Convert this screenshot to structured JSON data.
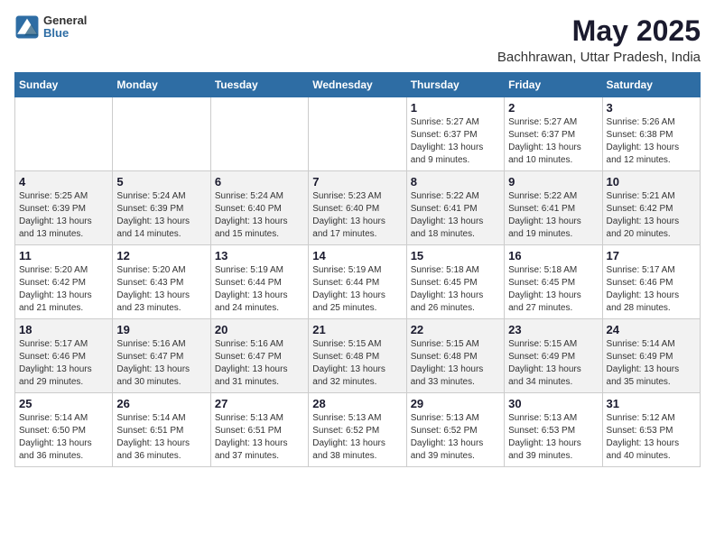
{
  "logo": {
    "line1": "General",
    "line2": "Blue"
  },
  "title": "May 2025",
  "subtitle": "Bachhrawan, Uttar Pradesh, India",
  "days_header": [
    "Sunday",
    "Monday",
    "Tuesday",
    "Wednesday",
    "Thursday",
    "Friday",
    "Saturday"
  ],
  "weeks": [
    [
      {
        "day": "",
        "info": ""
      },
      {
        "day": "",
        "info": ""
      },
      {
        "day": "",
        "info": ""
      },
      {
        "day": "",
        "info": ""
      },
      {
        "day": "1",
        "info": "Sunrise: 5:27 AM\nSunset: 6:37 PM\nDaylight: 13 hours and 9 minutes."
      },
      {
        "day": "2",
        "info": "Sunrise: 5:27 AM\nSunset: 6:37 PM\nDaylight: 13 hours and 10 minutes."
      },
      {
        "day": "3",
        "info": "Sunrise: 5:26 AM\nSunset: 6:38 PM\nDaylight: 13 hours and 12 minutes."
      }
    ],
    [
      {
        "day": "4",
        "info": "Sunrise: 5:25 AM\nSunset: 6:39 PM\nDaylight: 13 hours and 13 minutes."
      },
      {
        "day": "5",
        "info": "Sunrise: 5:24 AM\nSunset: 6:39 PM\nDaylight: 13 hours and 14 minutes."
      },
      {
        "day": "6",
        "info": "Sunrise: 5:24 AM\nSunset: 6:40 PM\nDaylight: 13 hours and 15 minutes."
      },
      {
        "day": "7",
        "info": "Sunrise: 5:23 AM\nSunset: 6:40 PM\nDaylight: 13 hours and 17 minutes."
      },
      {
        "day": "8",
        "info": "Sunrise: 5:22 AM\nSunset: 6:41 PM\nDaylight: 13 hours and 18 minutes."
      },
      {
        "day": "9",
        "info": "Sunrise: 5:22 AM\nSunset: 6:41 PM\nDaylight: 13 hours and 19 minutes."
      },
      {
        "day": "10",
        "info": "Sunrise: 5:21 AM\nSunset: 6:42 PM\nDaylight: 13 hours and 20 minutes."
      }
    ],
    [
      {
        "day": "11",
        "info": "Sunrise: 5:20 AM\nSunset: 6:42 PM\nDaylight: 13 hours and 21 minutes."
      },
      {
        "day": "12",
        "info": "Sunrise: 5:20 AM\nSunset: 6:43 PM\nDaylight: 13 hours and 23 minutes."
      },
      {
        "day": "13",
        "info": "Sunrise: 5:19 AM\nSunset: 6:44 PM\nDaylight: 13 hours and 24 minutes."
      },
      {
        "day": "14",
        "info": "Sunrise: 5:19 AM\nSunset: 6:44 PM\nDaylight: 13 hours and 25 minutes."
      },
      {
        "day": "15",
        "info": "Sunrise: 5:18 AM\nSunset: 6:45 PM\nDaylight: 13 hours and 26 minutes."
      },
      {
        "day": "16",
        "info": "Sunrise: 5:18 AM\nSunset: 6:45 PM\nDaylight: 13 hours and 27 minutes."
      },
      {
        "day": "17",
        "info": "Sunrise: 5:17 AM\nSunset: 6:46 PM\nDaylight: 13 hours and 28 minutes."
      }
    ],
    [
      {
        "day": "18",
        "info": "Sunrise: 5:17 AM\nSunset: 6:46 PM\nDaylight: 13 hours and 29 minutes."
      },
      {
        "day": "19",
        "info": "Sunrise: 5:16 AM\nSunset: 6:47 PM\nDaylight: 13 hours and 30 minutes."
      },
      {
        "day": "20",
        "info": "Sunrise: 5:16 AM\nSunset: 6:47 PM\nDaylight: 13 hours and 31 minutes."
      },
      {
        "day": "21",
        "info": "Sunrise: 5:15 AM\nSunset: 6:48 PM\nDaylight: 13 hours and 32 minutes."
      },
      {
        "day": "22",
        "info": "Sunrise: 5:15 AM\nSunset: 6:48 PM\nDaylight: 13 hours and 33 minutes."
      },
      {
        "day": "23",
        "info": "Sunrise: 5:15 AM\nSunset: 6:49 PM\nDaylight: 13 hours and 34 minutes."
      },
      {
        "day": "24",
        "info": "Sunrise: 5:14 AM\nSunset: 6:49 PM\nDaylight: 13 hours and 35 minutes."
      }
    ],
    [
      {
        "day": "25",
        "info": "Sunrise: 5:14 AM\nSunset: 6:50 PM\nDaylight: 13 hours and 36 minutes."
      },
      {
        "day": "26",
        "info": "Sunrise: 5:14 AM\nSunset: 6:51 PM\nDaylight: 13 hours and 36 minutes."
      },
      {
        "day": "27",
        "info": "Sunrise: 5:13 AM\nSunset: 6:51 PM\nDaylight: 13 hours and 37 minutes."
      },
      {
        "day": "28",
        "info": "Sunrise: 5:13 AM\nSunset: 6:52 PM\nDaylight: 13 hours and 38 minutes."
      },
      {
        "day": "29",
        "info": "Sunrise: 5:13 AM\nSunset: 6:52 PM\nDaylight: 13 hours and 39 minutes."
      },
      {
        "day": "30",
        "info": "Sunrise: 5:13 AM\nSunset: 6:53 PM\nDaylight: 13 hours and 39 minutes."
      },
      {
        "day": "31",
        "info": "Sunrise: 5:12 AM\nSunset: 6:53 PM\nDaylight: 13 hours and 40 minutes."
      }
    ]
  ]
}
